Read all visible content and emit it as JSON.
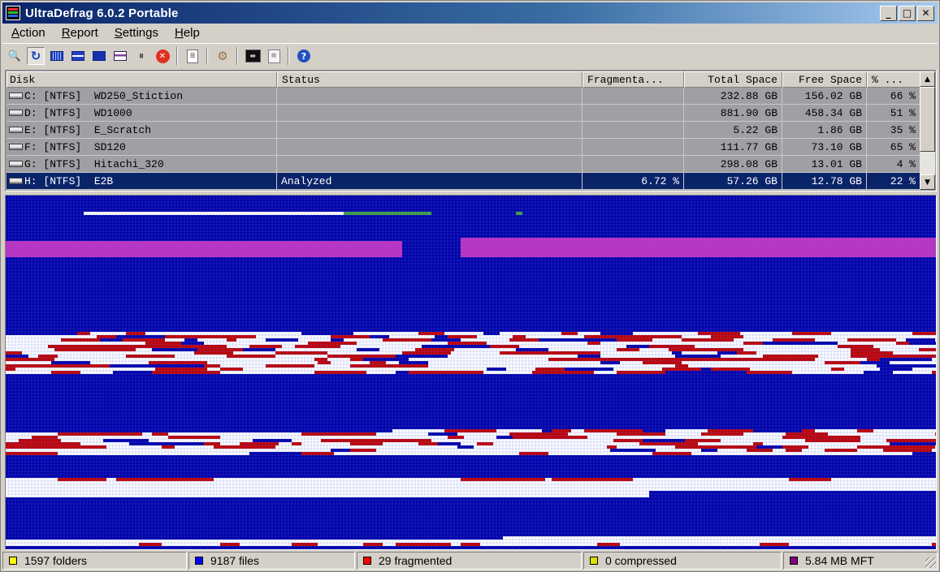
{
  "window": {
    "title": "UltraDefrag 6.0.2 Portable",
    "minimize_glyph": "_",
    "maximize_glyph": "□",
    "close_glyph": "✕"
  },
  "menu": [
    "Action",
    "Report",
    "Settings",
    "Help"
  ],
  "toolbar": [
    {
      "name": "analyze-icon",
      "glyph": "🔍"
    },
    {
      "name": "repeat-icon",
      "glyph": "↻"
    },
    {
      "name": "defragment-icon",
      "glyph": ""
    },
    {
      "name": "quick-optimize-icon",
      "glyph": ""
    },
    {
      "name": "full-optimize-icon",
      "glyph": ""
    },
    {
      "name": "optimize-mft-icon",
      "glyph": ""
    },
    {
      "name": "pause-icon",
      "glyph": "⏸"
    },
    {
      "name": "stop-icon",
      "glyph": "✕"
    },
    {
      "name": "report-icon",
      "glyph": "≣"
    },
    {
      "name": "preferences-icon",
      "glyph": "⚙"
    },
    {
      "name": "boot-time-icon",
      "glyph": "▬"
    },
    {
      "name": "script-icon",
      "glyph": "≡"
    },
    {
      "name": "help-icon",
      "glyph": "?"
    }
  ],
  "disk_list": {
    "columns": [
      "Disk",
      "Status",
      "Fragmenta...",
      "Total Space",
      "Free Space",
      "% ..."
    ],
    "rows": [
      {
        "disk": "C: [NTFS]  WD250_Stiction",
        "status": "",
        "frag": "",
        "total": "232.88 GB",
        "free": "156.02 GB",
        "pct": "66 %"
      },
      {
        "disk": "D: [NTFS]  WD1000",
        "status": "",
        "frag": "",
        "total": "881.90 GB",
        "free": "458.34 GB",
        "pct": "51 %"
      },
      {
        "disk": "E: [NTFS]  E_Scratch",
        "status": "",
        "frag": "",
        "total": "5.22 GB",
        "free": "1.86 GB",
        "pct": "35 %"
      },
      {
        "disk": "F: [NTFS]  SD120",
        "status": "",
        "frag": "",
        "total": "111.77 GB",
        "free": "73.10 GB",
        "pct": "65 %"
      },
      {
        "disk": "G: [NTFS]  Hitachi_320",
        "status": "",
        "frag": "",
        "total": "298.08 GB",
        "free": "13.01 GB",
        "pct": "4 %"
      },
      {
        "disk": "H: [NTFS]  E2B",
        "status": "Analyzed",
        "frag": "6.72 %",
        "total": "57.26 GB",
        "free": "12.78 GB",
        "pct": "22 %",
        "selected": true
      }
    ]
  },
  "cluster_map": {
    "colors": {
      "free": "#ffffff",
      "unfragmented": "#0000a8",
      "fragmented": "#c00000",
      "mft": "#c030c0",
      "system": "#40a040",
      "grid": "#6070e0"
    }
  },
  "status_bar": {
    "folders": {
      "label": "1597 folders",
      "color": "#ffff00"
    },
    "files": {
      "label": "9187 files",
      "color": "#0000ff"
    },
    "fragmented": {
      "label": "29 fragmented",
      "color": "#ff0000"
    },
    "compressed": {
      "label": "0 compressed",
      "color": "#e0e000"
    },
    "mft": {
      "label": "5.84 MB MFT",
      "color": "#800080"
    }
  }
}
